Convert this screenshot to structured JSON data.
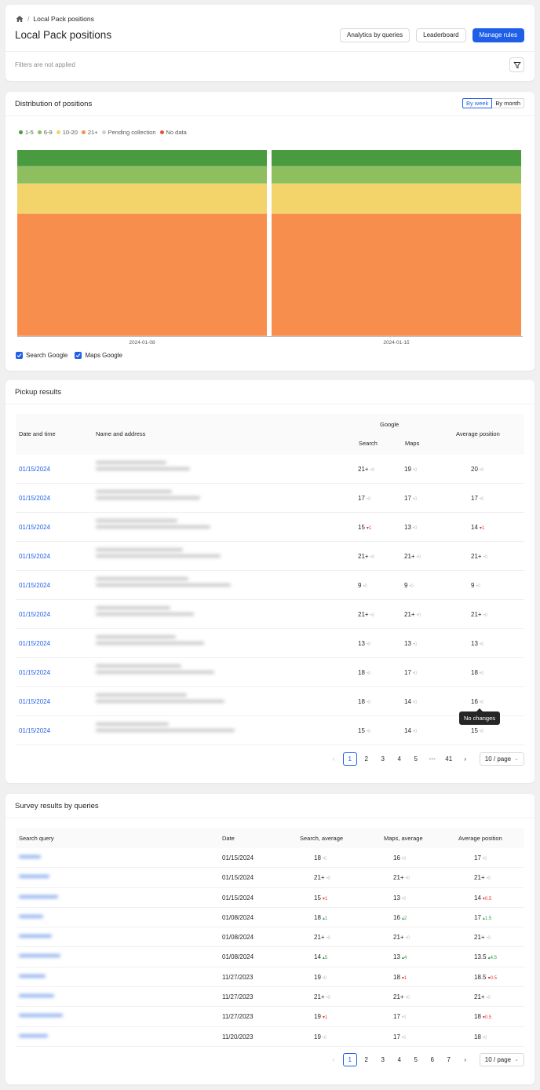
{
  "breadcrumb": {
    "current": "Local Pack positions"
  },
  "header": {
    "title": "Local Pack positions",
    "btn_analytics": "Analytics by queries",
    "btn_leaderboard": "Leaderboard",
    "btn_rules": "Manage rules",
    "filters_text": "Filters are not applied"
  },
  "distribution": {
    "title": "Distribution of positions",
    "by_week": "By week",
    "by_month": "By month",
    "legend": [
      {
        "label": "1-5",
        "color": "#4a9a3f"
      },
      {
        "label": "6-9",
        "color": "#8fbe5e"
      },
      {
        "label": "10-20",
        "color": "#f2d46b"
      },
      {
        "label": "21+",
        "color": "#f78e4e"
      },
      {
        "label": "Pending collection",
        "color": "#d0d0d0"
      },
      {
        "label": "No data",
        "color": "#e5533d"
      }
    ],
    "checks": {
      "search": "Search Google",
      "maps": "Maps Google"
    }
  },
  "chart_data": {
    "type": "bar",
    "stacked": true,
    "normalized_percent": true,
    "categories": [
      "2024-01-08",
      "2024-01-15"
    ],
    "series": [
      {
        "name": "1-5",
        "values": [
          9,
          9
        ]
      },
      {
        "name": "6-9",
        "values": [
          9,
          9
        ]
      },
      {
        "name": "10-20",
        "values": [
          16,
          16
        ]
      },
      {
        "name": "21+",
        "values": [
          66,
          66
        ]
      },
      {
        "name": "Pending collection",
        "values": [
          0,
          0
        ]
      },
      {
        "name": "No data",
        "values": [
          0,
          0
        ]
      }
    ],
    "legend": "top-left",
    "grid": false
  },
  "pickup": {
    "title": "Pickup results",
    "headers": {
      "date": "Date and time",
      "name": "Name and address",
      "google": "Google",
      "search": "Search",
      "maps": "Maps",
      "avg": "Average position"
    },
    "rows": [
      {
        "date": "01/15/2024",
        "search": "21+",
        "sd": "0",
        "sdt": "zero",
        "maps": "19",
        "md": "0",
        "mdt": "zero",
        "avg": "20",
        "ad": "0",
        "adt": "zero"
      },
      {
        "date": "01/15/2024",
        "search": "17",
        "sd": "0",
        "sdt": "zero",
        "maps": "17",
        "md": "0",
        "mdt": "zero",
        "avg": "17",
        "ad": "0",
        "adt": "zero"
      },
      {
        "date": "01/15/2024",
        "search": "15",
        "sd": "1",
        "sdt": "down",
        "maps": "13",
        "md": "0",
        "mdt": "zero",
        "avg": "14",
        "ad": "1",
        "adt": "down"
      },
      {
        "date": "01/15/2024",
        "search": "21+",
        "sd": "0",
        "sdt": "zero",
        "maps": "21+",
        "md": "0",
        "mdt": "zero",
        "avg": "21+",
        "ad": "0",
        "adt": "zero"
      },
      {
        "date": "01/15/2024",
        "search": "9",
        "sd": "0",
        "sdt": "zero",
        "maps": "9",
        "md": "0",
        "mdt": "zero",
        "avg": "9",
        "ad": "0",
        "adt": "zero"
      },
      {
        "date": "01/15/2024",
        "search": "21+",
        "sd": "0",
        "sdt": "zero",
        "maps": "21+",
        "md": "0",
        "mdt": "zero",
        "avg": "21+",
        "ad": "0",
        "adt": "zero"
      },
      {
        "date": "01/15/2024",
        "search": "13",
        "sd": "0",
        "sdt": "zero",
        "maps": "13",
        "md": "0",
        "mdt": "zero",
        "avg": "13",
        "ad": "0",
        "adt": "zero"
      },
      {
        "date": "01/15/2024",
        "search": "18",
        "sd": "0",
        "sdt": "zero",
        "maps": "17",
        "md": "0",
        "mdt": "zero",
        "avg": "18",
        "ad": "0",
        "adt": "zero"
      },
      {
        "date": "01/15/2024",
        "search": "18",
        "sd": "0",
        "sdt": "zero",
        "maps": "14",
        "md": "0",
        "mdt": "zero",
        "avg": "16",
        "ad": "0",
        "adt": "zero"
      },
      {
        "date": "01/15/2024",
        "search": "15",
        "sd": "0",
        "sdt": "zero",
        "maps": "14",
        "md": "0",
        "mdt": "zero",
        "avg": "15",
        "ad": "0",
        "adt": "zero"
      }
    ],
    "tooltip": "No changes",
    "pages": [
      "1",
      "2",
      "3",
      "4",
      "5",
      "•••",
      "41"
    ],
    "page_size": "10 / page"
  },
  "survey": {
    "title": "Survey results by queries",
    "headers": {
      "query": "Search query",
      "date": "Date",
      "search": "Search, average",
      "maps": "Maps, average",
      "avg": "Average position"
    },
    "rows": [
      {
        "date": "01/15/2024",
        "search": "18",
        "sd": "0",
        "sdt": "zero",
        "maps": "16",
        "md": "0",
        "mdt": "zero",
        "avg": "17",
        "ad": "0",
        "adt": "zero"
      },
      {
        "date": "01/15/2024",
        "search": "21+",
        "sd": "0",
        "sdt": "zero",
        "maps": "21+",
        "md": "0",
        "mdt": "zero",
        "avg": "21+",
        "ad": "0",
        "adt": "zero"
      },
      {
        "date": "01/15/2024",
        "search": "15",
        "sd": "1",
        "sdt": "down",
        "maps": "13",
        "md": "0",
        "mdt": "zero",
        "avg": "14",
        "ad": "0.5",
        "adt": "down"
      },
      {
        "date": "01/08/2024",
        "search": "18",
        "sd": "1",
        "sdt": "up",
        "maps": "16",
        "md": "2",
        "mdt": "up",
        "avg": "17",
        "ad": "1.5",
        "adt": "up"
      },
      {
        "date": "01/08/2024",
        "search": "21+",
        "sd": "0",
        "sdt": "zero",
        "maps": "21+",
        "md": "0",
        "mdt": "zero",
        "avg": "21+",
        "ad": "0",
        "adt": "zero"
      },
      {
        "date": "01/08/2024",
        "search": "14",
        "sd": "5",
        "sdt": "up",
        "maps": "13",
        "md": "4",
        "mdt": "up",
        "avg": "13.5",
        "ad": "4.5",
        "adt": "up"
      },
      {
        "date": "11/27/2023",
        "search": "19",
        "sd": "0",
        "sdt": "zero",
        "maps": "18",
        "md": "1",
        "mdt": "down",
        "avg": "18.5",
        "ad": "0.5",
        "adt": "down"
      },
      {
        "date": "11/27/2023",
        "search": "21+",
        "sd": "0",
        "sdt": "zero",
        "maps": "21+",
        "md": "0",
        "mdt": "zero",
        "avg": "21+",
        "ad": "0",
        "adt": "zero"
      },
      {
        "date": "11/27/2023",
        "search": "19",
        "sd": "1",
        "sdt": "down",
        "maps": "17",
        "md": "0",
        "mdt": "zero",
        "avg": "18",
        "ad": "0.5",
        "adt": "down"
      },
      {
        "date": "11/20/2023",
        "search": "19",
        "sd": "0",
        "sdt": "zero",
        "maps": "17",
        "md": "0",
        "mdt": "zero",
        "avg": "18",
        "ad": "0",
        "adt": "zero"
      }
    ],
    "pages": [
      "1",
      "2",
      "3",
      "4",
      "5",
      "6",
      "7"
    ],
    "page_size": "10 / page"
  }
}
